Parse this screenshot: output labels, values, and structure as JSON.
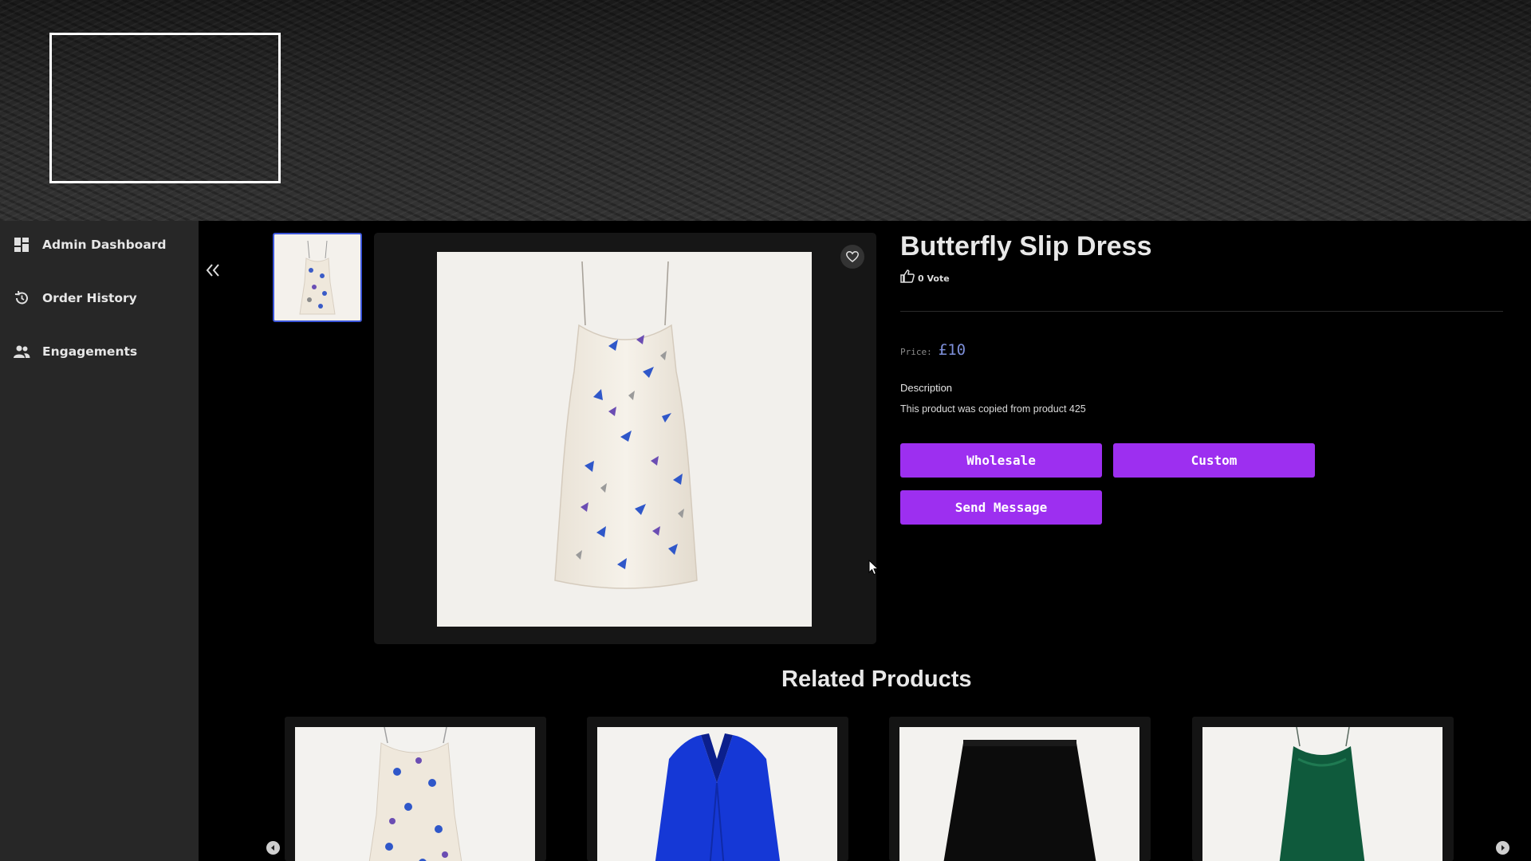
{
  "sidebar": {
    "items": [
      {
        "label": "Admin Dashboard",
        "icon": "dashboard-icon"
      },
      {
        "label": "Order History",
        "icon": "history-icon"
      },
      {
        "label": "Engagements",
        "icon": "people-icon"
      }
    ]
  },
  "product": {
    "title": "Butterfly Slip Dress",
    "votes": "0 Vote",
    "price_label": "Price:",
    "price": "£10",
    "description_label": "Description",
    "description": "This product was copied from product 425"
  },
  "actions": {
    "wholesale": "Wholesale",
    "custom": "Custom",
    "send_message": "Send Message"
  },
  "related": {
    "title": "Related Products"
  },
  "colors": {
    "accent": "#9d2ff0",
    "price": "#7d8fd9",
    "sidebar_bg": "#272727",
    "thumb_border": "#3b55d9"
  }
}
